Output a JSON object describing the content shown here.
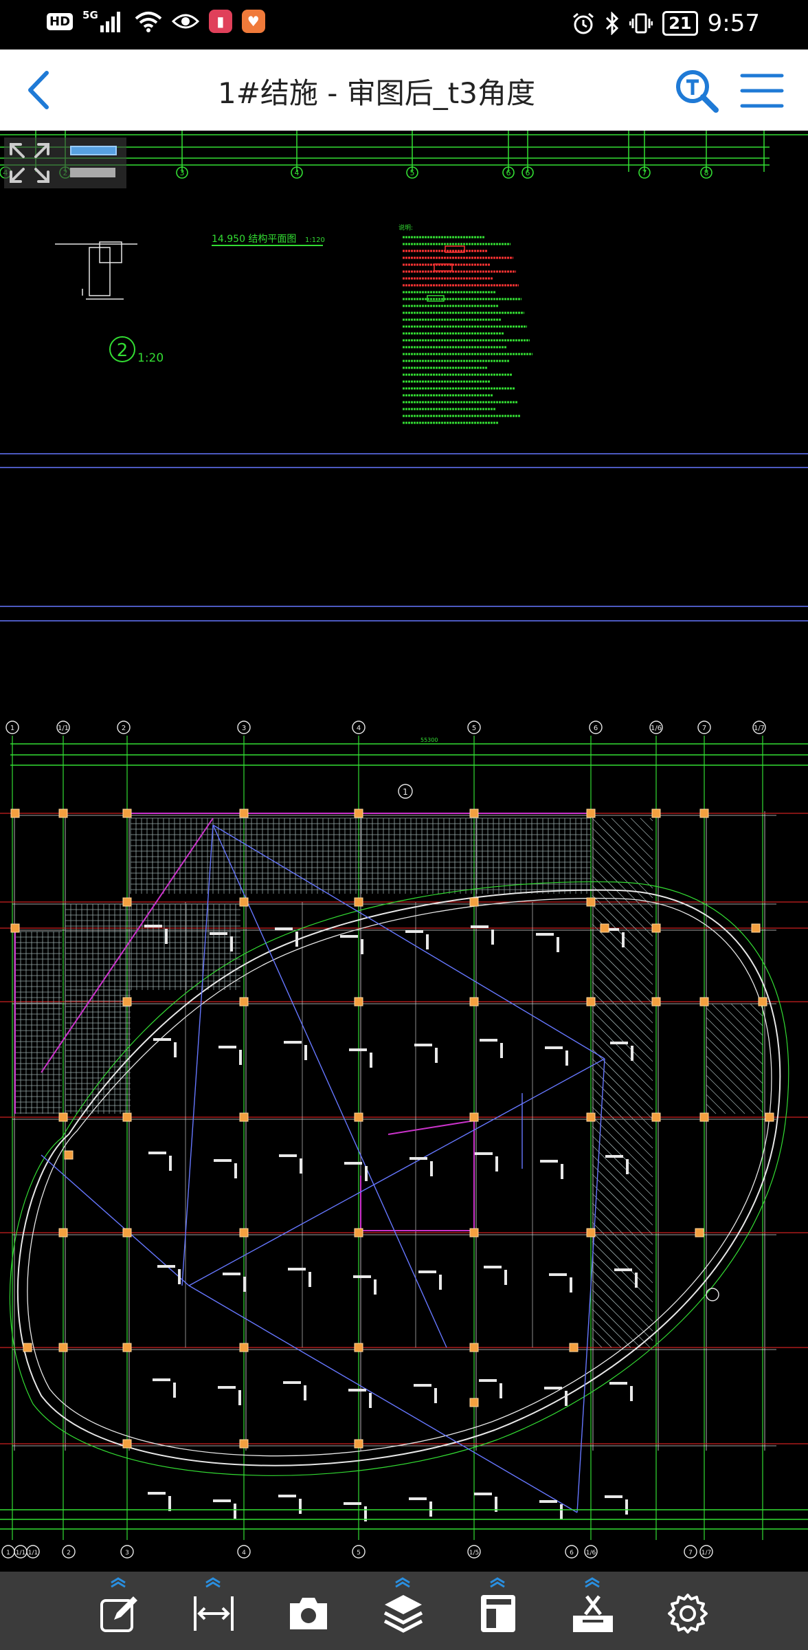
{
  "status_bar": {
    "hd": "HD",
    "network": "5G",
    "battery": "21",
    "time": "9:57"
  },
  "titlebar": {
    "title": "1#结施 - 审图后_t3角度"
  },
  "drawing": {
    "detail_title": "14.950  结构平面图",
    "detail_scale": "1:120",
    "section_number": "2",
    "section_scale": "1:20",
    "notes_heading": "说明:",
    "top_axis_labels": [
      "4",
      "2",
      "3",
      "4",
      "5",
      "6",
      "6",
      "7",
      "8"
    ],
    "plan_top_axis_labels": [
      "1",
      "1/1",
      "2",
      "3",
      "4",
      "5",
      "6",
      "1/6",
      "7",
      "1/7"
    ],
    "plan_bottom_axis_labels": [
      "1",
      "1/1",
      "1/1",
      "2",
      "3",
      "4",
      "5",
      "1/5",
      "6",
      "1/6",
      "7",
      "1/7"
    ],
    "plan_total_dim": "55300",
    "marker": "1"
  },
  "colors": {
    "canvas_bg": "#000000",
    "grid_green": "#33dd33",
    "beam_white": "#e8e8e8",
    "axis_red": "#cc2020",
    "slab_magenta": "#cc33cc",
    "guide_blue": "#6677ff",
    "column_orange": "#f4a040",
    "accent": "#1f7ad6",
    "toolbar_bg": "#3b3b3b"
  },
  "toolbar": {
    "items": [
      "edit-icon",
      "measure-icon",
      "camera-icon",
      "layers-icon",
      "layout-icon",
      "toolbox-icon",
      "settings-icon"
    ]
  }
}
